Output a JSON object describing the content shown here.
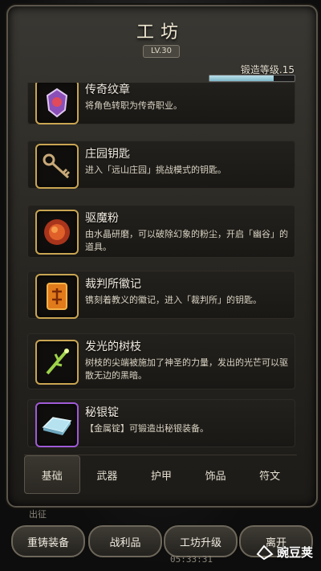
{
  "header": {
    "title": "工坊",
    "level_badge": "LV.30",
    "forge_level_label": "锻造等级.15",
    "forge_progress": 0.75
  },
  "items": [
    {
      "name": "传奇纹章",
      "desc": "将角色转职为传奇职业。",
      "icon": "legend-crest-icon"
    },
    {
      "name": "庄园钥匙",
      "desc": "进入「远山庄园」挑战模式的钥匙。",
      "icon": "key-icon"
    },
    {
      "name": "驱魔粉",
      "desc": "由水晶研磨，可以破除幻象的粉尘，开启「幽谷」的道具。",
      "icon": "exorcism-powder-icon"
    },
    {
      "name": "裁判所徽记",
      "desc": "镌刻着教义的徽记，进入「裁判所」的钥匙。",
      "icon": "tribunal-emblem-icon"
    },
    {
      "name": "发光的树枝",
      "desc": "树枝的尖端被施加了神圣的力量，发出的光芒可以驱散无边的黑暗。",
      "icon": "glowing-branch-icon"
    },
    {
      "name": "秘银锭",
      "desc": "【金属锭】可锻造出秘银装备。",
      "icon": "mithril-ingot-icon"
    }
  ],
  "tabs": [
    "基础",
    "武器",
    "护甲",
    "饰品",
    "符文"
  ],
  "active_tab": "基础",
  "behind_text": "出征",
  "bottom_buttons": [
    "重铸装备",
    "战利品",
    "工坊升级",
    "离开"
  ],
  "clock": "05:33:31",
  "watermark": "豌豆荚",
  "colors": {
    "gold_border": "#c9a552",
    "purple_border": "#a05ad6",
    "progress_fill": "#9fd0dd"
  }
}
